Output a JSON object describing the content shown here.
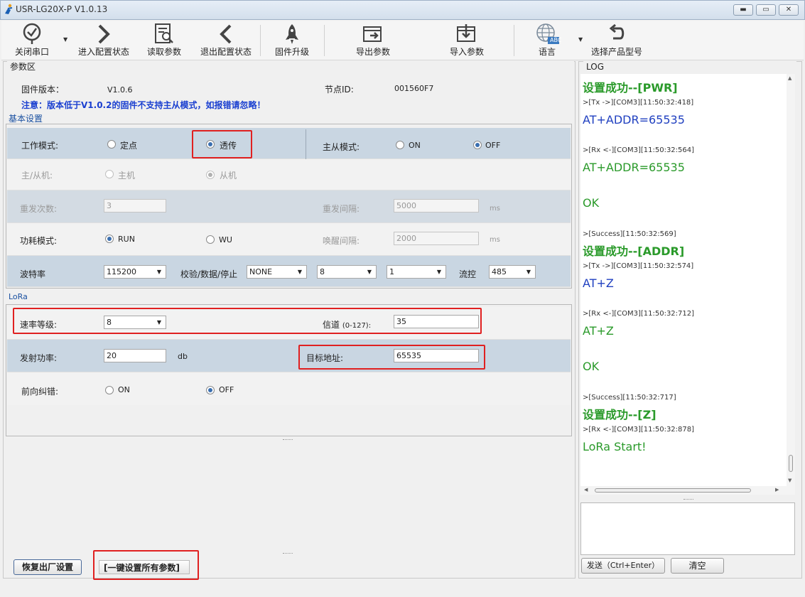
{
  "app": {
    "title": "USR-LG20X-P  V1.0.13"
  },
  "window_controls": {
    "minimize": "▬",
    "maximize": "▭",
    "close": "✕"
  },
  "toolbar": {
    "close_port": "关闭串口",
    "enter_config": "进入配置状态",
    "read_params": "读取参数",
    "exit_config": "退出配置状态",
    "firmware": "固件升级",
    "export": "导出参数",
    "import": "导入参数",
    "language": "语言",
    "language_badge": "ABC",
    "select_model": "选择产品型号"
  },
  "params": {
    "panel_title": "参数区",
    "fw_label": "固件版本：",
    "fw_value": "V1.0.6",
    "node_label": "节点ID:",
    "node_value": "001560F7",
    "notice": "注意：版本低于V1.0.2的固件不支持主从模式，如报错请忽略！"
  },
  "basic": {
    "title": "基本设置",
    "work_mode_label": "工作模式:",
    "work_mode_opt1": "定点",
    "work_mode_opt2": "透传",
    "master_mode_label": "主从模式:",
    "master_on": "ON",
    "master_off": "OFF",
    "role_label": "主/从机:",
    "role_master": "主机",
    "role_slave": "从机",
    "retry_label": "重发次数:",
    "retry_value": "3",
    "retry_interval_label": "重发间隔:",
    "retry_interval_value": "5000",
    "retry_interval_unit": "ms",
    "power_label": "功耗模式:",
    "power_run": "RUN",
    "power_wu": "WU",
    "wake_label": "唤醒间隔:",
    "wake_value": "2000",
    "wake_unit": "ms",
    "baud_label": "波特率",
    "baud_value": "115200",
    "parity_label": "校验/数据/停止",
    "parity_value": "NONE",
    "data_bits": "8",
    "stop_bits": "1",
    "flow_label": "流控",
    "flow_value": "485"
  },
  "lora": {
    "title": "LoRa",
    "rate_label": "速率等级:",
    "rate_value": "8",
    "channel_label": "信道",
    "channel_range": "(0-127):",
    "channel_value": "35",
    "tx_power_label": "发射功率:",
    "tx_power_value": "20",
    "tx_power_unit": "db",
    "target_label": "目标地址:",
    "target_value": "65535",
    "fec_label": "前向纠错:",
    "fec_on": "ON",
    "fec_off": "OFF"
  },
  "bottom": {
    "restore": "恢复出厂设置",
    "set_all": "[一键设置所有参数]"
  },
  "log": {
    "title": "LOG",
    "entries": [
      {
        "kind": "ok",
        "text": "设置成功--[PWR]"
      },
      {
        "kind": "line",
        "text": ">[Tx ->][COM3][11:50:32:418]"
      },
      {
        "kind": "tx",
        "text": "AT+ADDR=65535"
      },
      {
        "kind": "line",
        "text": ">[Rx <-][COM3][11:50:32:564]"
      },
      {
        "kind": "rx",
        "text": "AT+ADDR=65535"
      },
      {
        "kind": "rx",
        "text": "OK"
      },
      {
        "kind": "line",
        "text": ">[Success][11:50:32:569]"
      },
      {
        "kind": "ok",
        "text": "设置成功--[ADDR]"
      },
      {
        "kind": "line",
        "text": ">[Tx ->][COM3][11:50:32:574]"
      },
      {
        "kind": "tx",
        "text": "AT+Z"
      },
      {
        "kind": "line",
        "text": ">[Rx <-][COM3][11:50:32:712]"
      },
      {
        "kind": "rx",
        "text": "AT+Z"
      },
      {
        "kind": "rx",
        "text": "OK"
      },
      {
        "kind": "line",
        "text": ">[Success][11:50:32:717]"
      },
      {
        "kind": "ok",
        "text": "设置成功--[Z]"
      },
      {
        "kind": "line",
        "text": ">[Rx <-][COM3][11:50:32:878]"
      },
      {
        "kind": "rx",
        "text": "LoRa Start!"
      }
    ],
    "send_button": "发送（Ctrl+Enter）",
    "clear_button": "清空",
    "send_input": ""
  },
  "colors": {
    "accent": "#1a50a0",
    "highlight": "#e02020",
    "log_ok": "#2a9a2a",
    "log_tx": "#2040c0"
  }
}
